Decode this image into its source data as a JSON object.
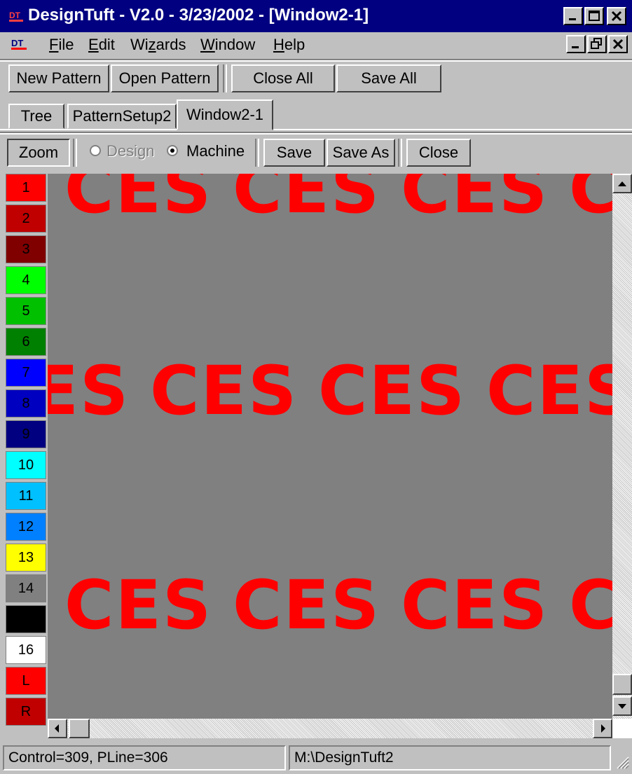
{
  "window": {
    "title": "DesignTuft - V2.0 - 3/23/2002 - [Window2-1]",
    "title_color": "#000080"
  },
  "menu": {
    "items": [
      {
        "label": "File",
        "accel": "F"
      },
      {
        "label": "Edit",
        "accel": "E"
      },
      {
        "label": "Wizards",
        "accel": "z"
      },
      {
        "label": "Window",
        "accel": "W"
      },
      {
        "label": "Help",
        "accel": "H"
      }
    ]
  },
  "toolbar": {
    "new_pattern": "New Pattern",
    "open_pattern": "Open Pattern",
    "close_all": "Close All",
    "save_all": "Save All"
  },
  "tabs": [
    "Tree",
    "PatternSetup2",
    "Window2-1"
  ],
  "active_tab": "Window2-1",
  "child_toolbar": {
    "zoom": "Zoom",
    "radio_design": "Design",
    "radio_machine": "Machine",
    "selected_mode": "Machine",
    "save": "Save",
    "save_as": "Save As",
    "close": "Close"
  },
  "palette": [
    {
      "label": "1",
      "color": "#ff0000",
      "text_color": "#000000"
    },
    {
      "label": "2",
      "color": "#c00000",
      "text_color": "#000000"
    },
    {
      "label": "3",
      "color": "#800000",
      "text_color": "#000000"
    },
    {
      "label": "4",
      "color": "#00ff00",
      "text_color": "#000000"
    },
    {
      "label": "5",
      "color": "#00c000",
      "text_color": "#000000"
    },
    {
      "label": "6",
      "color": "#008000",
      "text_color": "#000000"
    },
    {
      "label": "7",
      "color": "#0000ff",
      "text_color": "#000000"
    },
    {
      "label": "8",
      "color": "#0000c0",
      "text_color": "#000000"
    },
    {
      "label": "9",
      "color": "#000080",
      "text_color": "#000000"
    },
    {
      "label": "10",
      "color": "#00ffff",
      "text_color": "#000000"
    },
    {
      "label": "11",
      "color": "#00c0ff",
      "text_color": "#000000"
    },
    {
      "label": "12",
      "color": "#0080ff",
      "text_color": "#000000"
    },
    {
      "label": "13",
      "color": "#ffff00",
      "text_color": "#000000"
    },
    {
      "label": "14",
      "color": "#808080",
      "text_color": "#000000"
    },
    {
      "label": "",
      "color": "#000000",
      "text_color": "#ffffff"
    },
    {
      "label": "16",
      "color": "#ffffff",
      "text_color": "#000000"
    },
    {
      "label": "L",
      "color": "#ff0000",
      "text_color": "#000000"
    },
    {
      "label": "R",
      "color": "#c00000",
      "text_color": "#000000"
    }
  ],
  "canvas": {
    "background": "#808080",
    "text": "CES",
    "text_color": "#ff0000"
  },
  "status": {
    "left": "Control=309, PLine=306",
    "right": "M:\\DesignTuft2"
  }
}
